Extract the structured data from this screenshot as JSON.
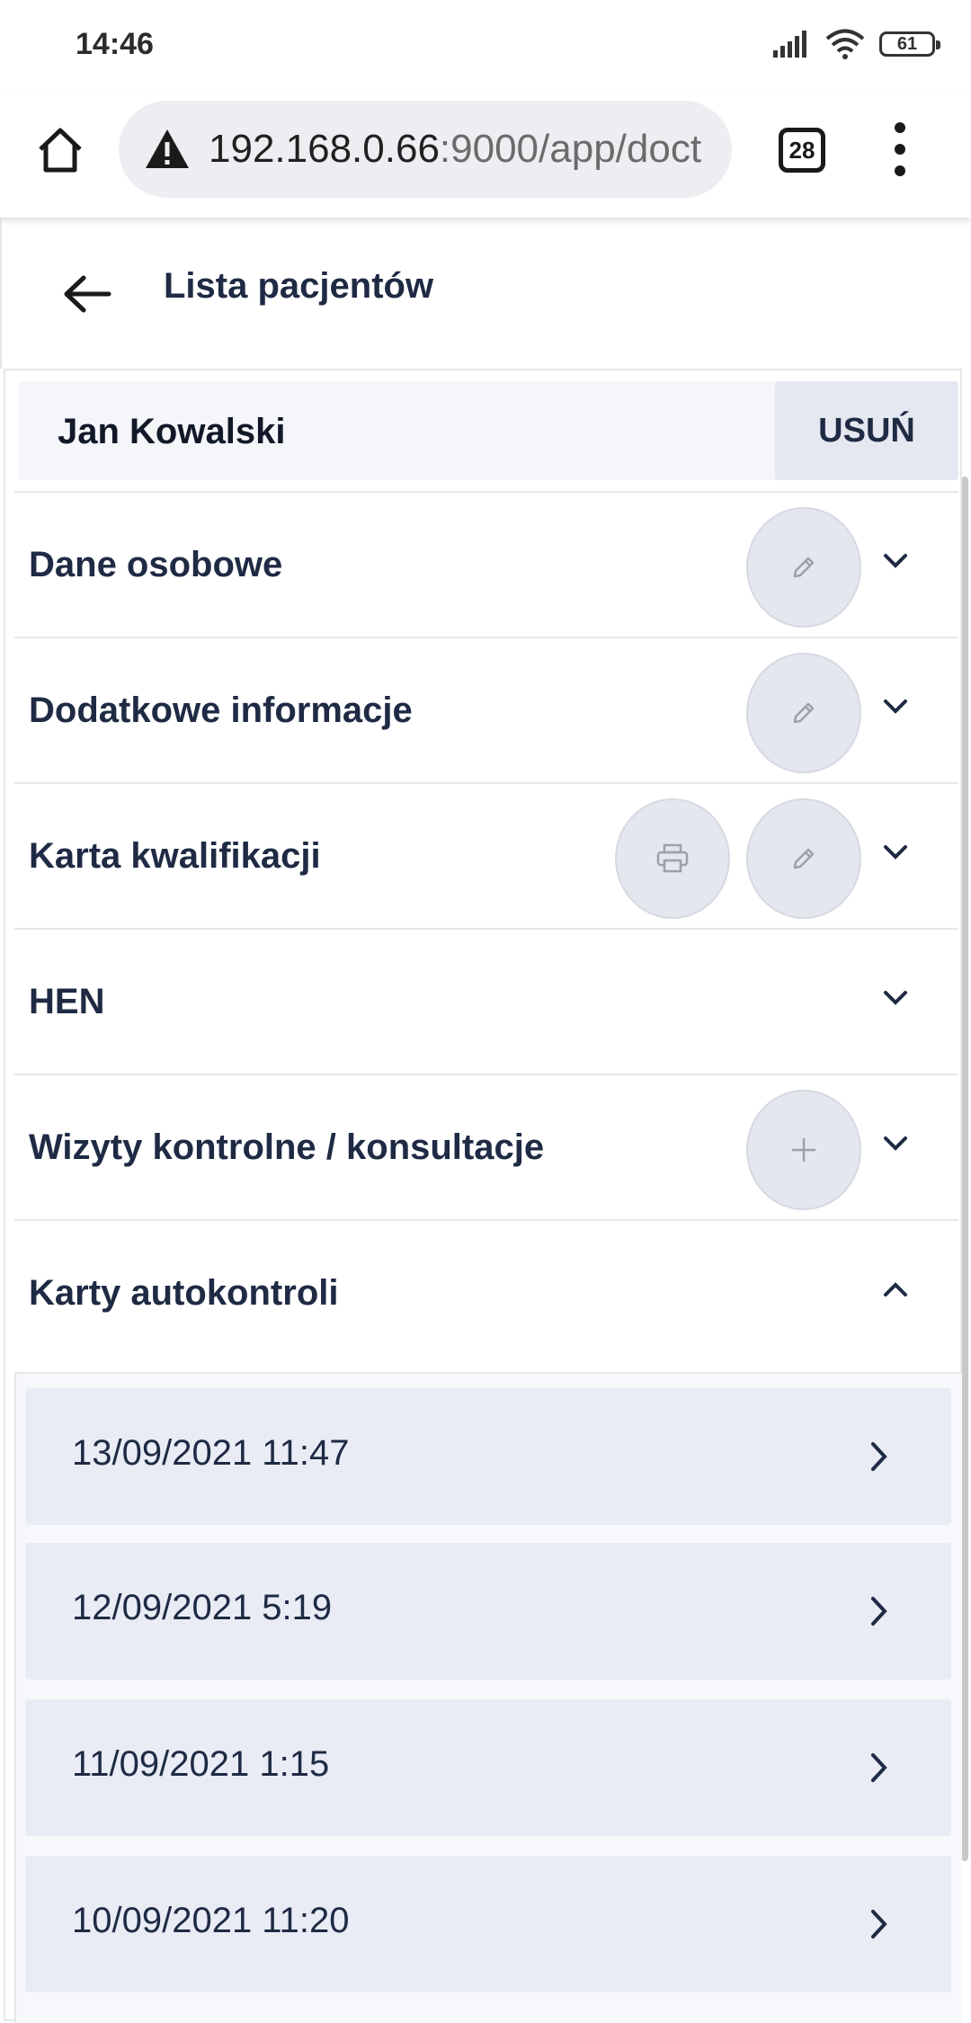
{
  "status_bar": {
    "time": "14:46",
    "battery": "61"
  },
  "browser": {
    "url_host": "192.168.0.66",
    "url_path": ":9000/app/doct",
    "tab_count": "28"
  },
  "header": {
    "title": "Lista pacjentów"
  },
  "patient": {
    "name": "Jan Kowalski",
    "delete_label": "USUŃ"
  },
  "sections": [
    {
      "title": "Dane osobowe",
      "actions": [
        "edit"
      ],
      "expanded": false
    },
    {
      "title": "Dodatkowe informacje",
      "actions": [
        "edit"
      ],
      "expanded": false
    },
    {
      "title": "Karta kwalifikacji",
      "actions": [
        "print",
        "edit"
      ],
      "expanded": false
    },
    {
      "title": "HEN",
      "actions": [],
      "expanded": false
    },
    {
      "title": "Wizyty kontrolne / konsultacje",
      "actions": [
        "add"
      ],
      "expanded": false
    },
    {
      "title": "Karty autokontroli",
      "actions": [],
      "expanded": true
    }
  ],
  "self_control_cards": [
    {
      "date": "13/09/2021 11:47"
    },
    {
      "date": "12/09/2021 5:19"
    },
    {
      "date": "11/09/2021 1:15"
    },
    {
      "date": "10/09/2021 11:20"
    }
  ],
  "icons": {
    "edit": "pencil-icon",
    "print": "printer-icon",
    "add": "plus-icon",
    "expand": "chevron-down-icon",
    "collapse": "chevron-up-icon",
    "open": "chevron-right-icon"
  },
  "colors": {
    "text_primary": "#1f2a44",
    "action_circle": "#e5e7ee",
    "list_item_bg": "#e9ecf5",
    "patient_bar_bg": "#f4f6fa"
  }
}
